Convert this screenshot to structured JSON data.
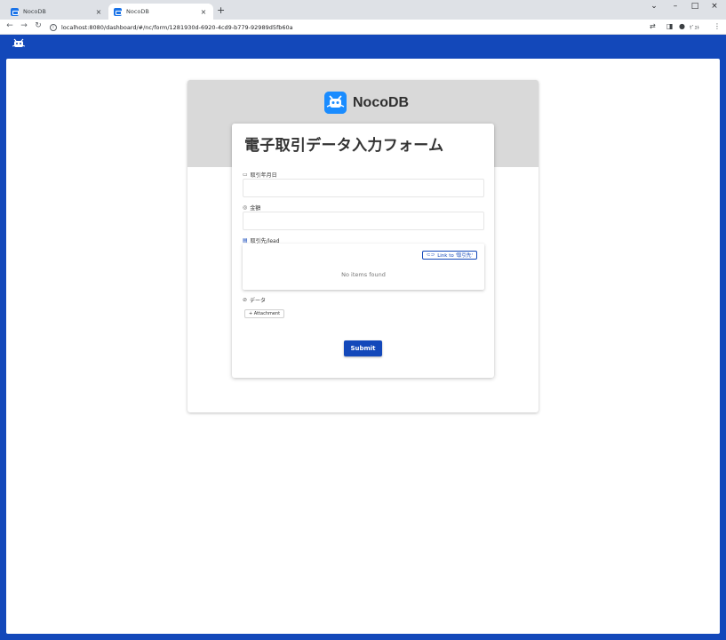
{
  "browser": {
    "tabs": [
      {
        "title": "NocoDB",
        "active": false
      },
      {
        "title": "NocoDB",
        "active": true
      }
    ],
    "new_tab_label": "+",
    "url": "localhost:8080/dashboard/#/nc/form/1281930d-6920-4cd9-b779-92989d5fb60a",
    "profile_label": "ｹﾞｽﾄ",
    "window_controls": {
      "minimize": "–",
      "maximize": "□",
      "close": "×",
      "tab_search": "⌄"
    }
  },
  "app": {
    "brand_name": "NocoDB",
    "accent_color": "#1348ba",
    "form": {
      "title": "電子取引データ入力フォーム",
      "fields": [
        {
          "label": "取引年月日",
          "icon": "calendar-icon",
          "type": "date"
        },
        {
          "label": "金額",
          "icon": "currency-icon",
          "type": "currency"
        },
        {
          "label": "取引先/lead",
          "icon": "link-table-icon",
          "type": "link"
        },
        {
          "label": "データ",
          "icon": "attachment-icon",
          "type": "attachment"
        }
      ],
      "link_button_label": "Link to '取引先'",
      "no_items_text": "No items found",
      "attachment_button_label": "+ Attachment",
      "submit_label": "Submit"
    }
  }
}
